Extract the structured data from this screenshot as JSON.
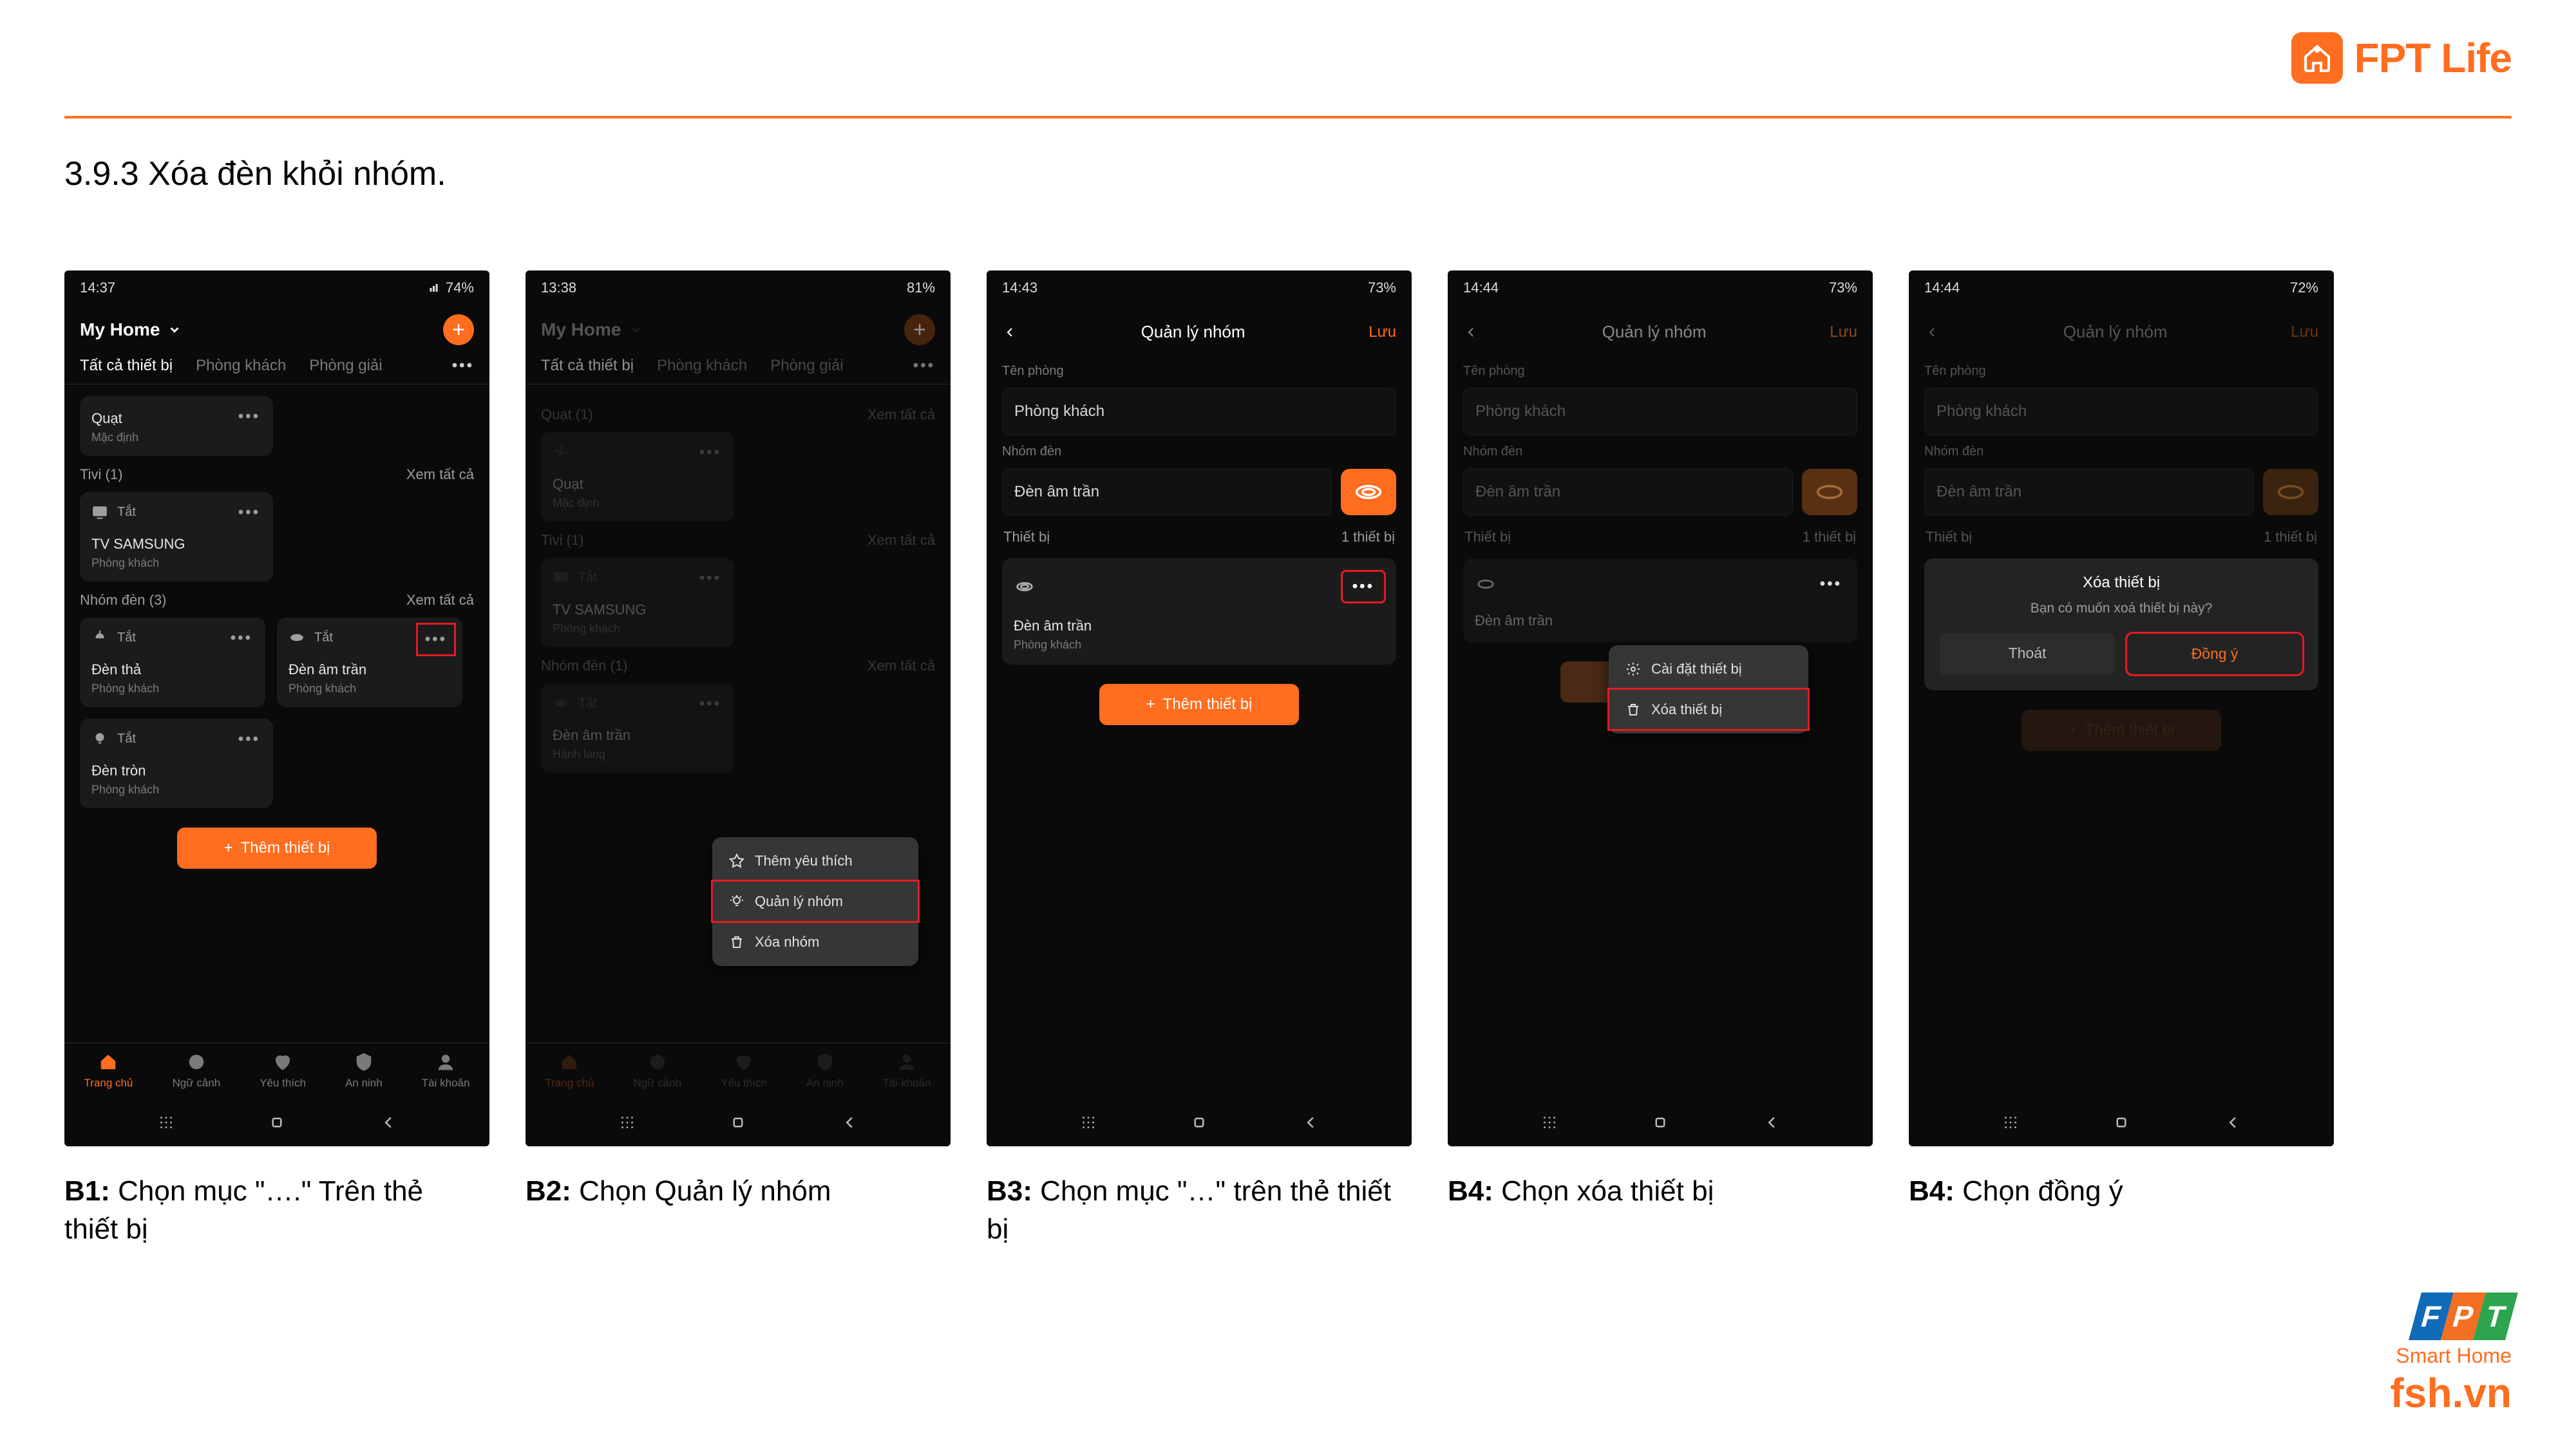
{
  "brand": {
    "name": "FPT Life"
  },
  "section_title": "3.9.3 Xóa đèn khỏi nhóm.",
  "nav": {
    "items": [
      "Trang chủ",
      "Ngữ cảnh",
      "Yêu thích",
      "An ninh",
      "Tài khoản"
    ]
  },
  "footer": {
    "smarthome": "Smart Home",
    "url": "fsh.vn"
  },
  "common": {
    "myhome": "My Home",
    "add_device": "Thêm thiết bị",
    "see_all": "Xem tất cả",
    "tabs": [
      "Tất cả thiết bị",
      "Phòng khách",
      "Phòng giải"
    ],
    "off": "Tắt",
    "default": "Mặc định"
  },
  "b1": {
    "status": {
      "time": "14:37",
      "battery": "74%"
    },
    "quat": {
      "name": "Quạt",
      "sub": "Mặc định"
    },
    "tivi": {
      "h": "Tivi (1)",
      "name": "TV SAMSUNG",
      "room": "Phòng khách",
      "state": "Tắt"
    },
    "group": {
      "h": "Nhóm đèn (3)",
      "d1": {
        "name": "Đèn thả",
        "room": "Phòng khách"
      },
      "d2": {
        "name": "Đèn âm trần",
        "room": "Phòng khách"
      },
      "d3": {
        "name": "Đèn tròn",
        "room": "Phòng khách"
      }
    },
    "cap_b": "B1:",
    "cap": " Chọn mục \"….\" Trên thẻ thiết bị"
  },
  "b2": {
    "status": {
      "time": "13:38",
      "battery": "81%"
    },
    "quat": {
      "h": "Quạt (1)",
      "name": "Quạt",
      "sub": "Mặc định"
    },
    "tivi": {
      "h": "Tivi (1)",
      "name": "TV SAMSUNG",
      "room": "Phòng khách",
      "state": "Tắt"
    },
    "group": {
      "h": "Nhóm đèn (1)",
      "name": "Đèn âm trần",
      "room": "Hành lang"
    },
    "menu": {
      "fav": "Thêm yêu thích",
      "manage": "Quản lý nhóm",
      "del": "Xóa nhóm"
    },
    "cap_b": "B2:",
    "cap": " Chọn Quản lý nhóm"
  },
  "b3": {
    "status": {
      "time": "14:43",
      "battery": "73%"
    },
    "hdr": "Quản lý nhóm",
    "save": "Lưu",
    "room_lbl": "Tên phòng",
    "room": "Phòng khách",
    "grp_lbl": "Nhóm đèn",
    "grp": "Đèn âm trần",
    "dev_lbl": "Thiết bị",
    "count": "1 thiết bị",
    "dev": {
      "name": "Đèn âm trần",
      "room": "Phòng khách"
    },
    "cap_b": "B3:",
    "cap": " Chọn mục \"…\" trên thẻ thiết bị"
  },
  "b4": {
    "status": {
      "time": "14:44",
      "battery": "73%"
    },
    "hdr": "Quản lý nhóm",
    "save": "Lưu",
    "room_lbl": "Tên phòng",
    "room": "Phòng khách",
    "grp_lbl": "Nhóm đèn",
    "grp": "Đèn âm trần",
    "dev_lbl": "Thiết bị",
    "count": "1 thiết bị",
    "dev": {
      "name": "Đèn âm trần"
    },
    "menu": {
      "settings": "Cài đặt thiết bị",
      "del": "Xóa thiết bị"
    },
    "cap_b": "B4:",
    "cap": " Chọn xóa thiết bị"
  },
  "b5": {
    "status": {
      "time": "14:44",
      "battery": "72%"
    },
    "hdr": "Quản lý nhóm",
    "save": "Lưu",
    "room_lbl": "Tên phòng",
    "room": "Phòng khách",
    "grp_lbl": "Nhóm đèn",
    "grp": "Đèn âm trần",
    "dev_lbl": "Thiết bị",
    "count": "1 thiết bị",
    "dlg": {
      "title": "Xóa thiết bị",
      "msg": "Bạn có muốn xoá thiết bị này?",
      "exit": "Thoát",
      "ok": "Đồng ý"
    },
    "cap_b": "B4:",
    "cap": " Chọn đồng ý"
  }
}
